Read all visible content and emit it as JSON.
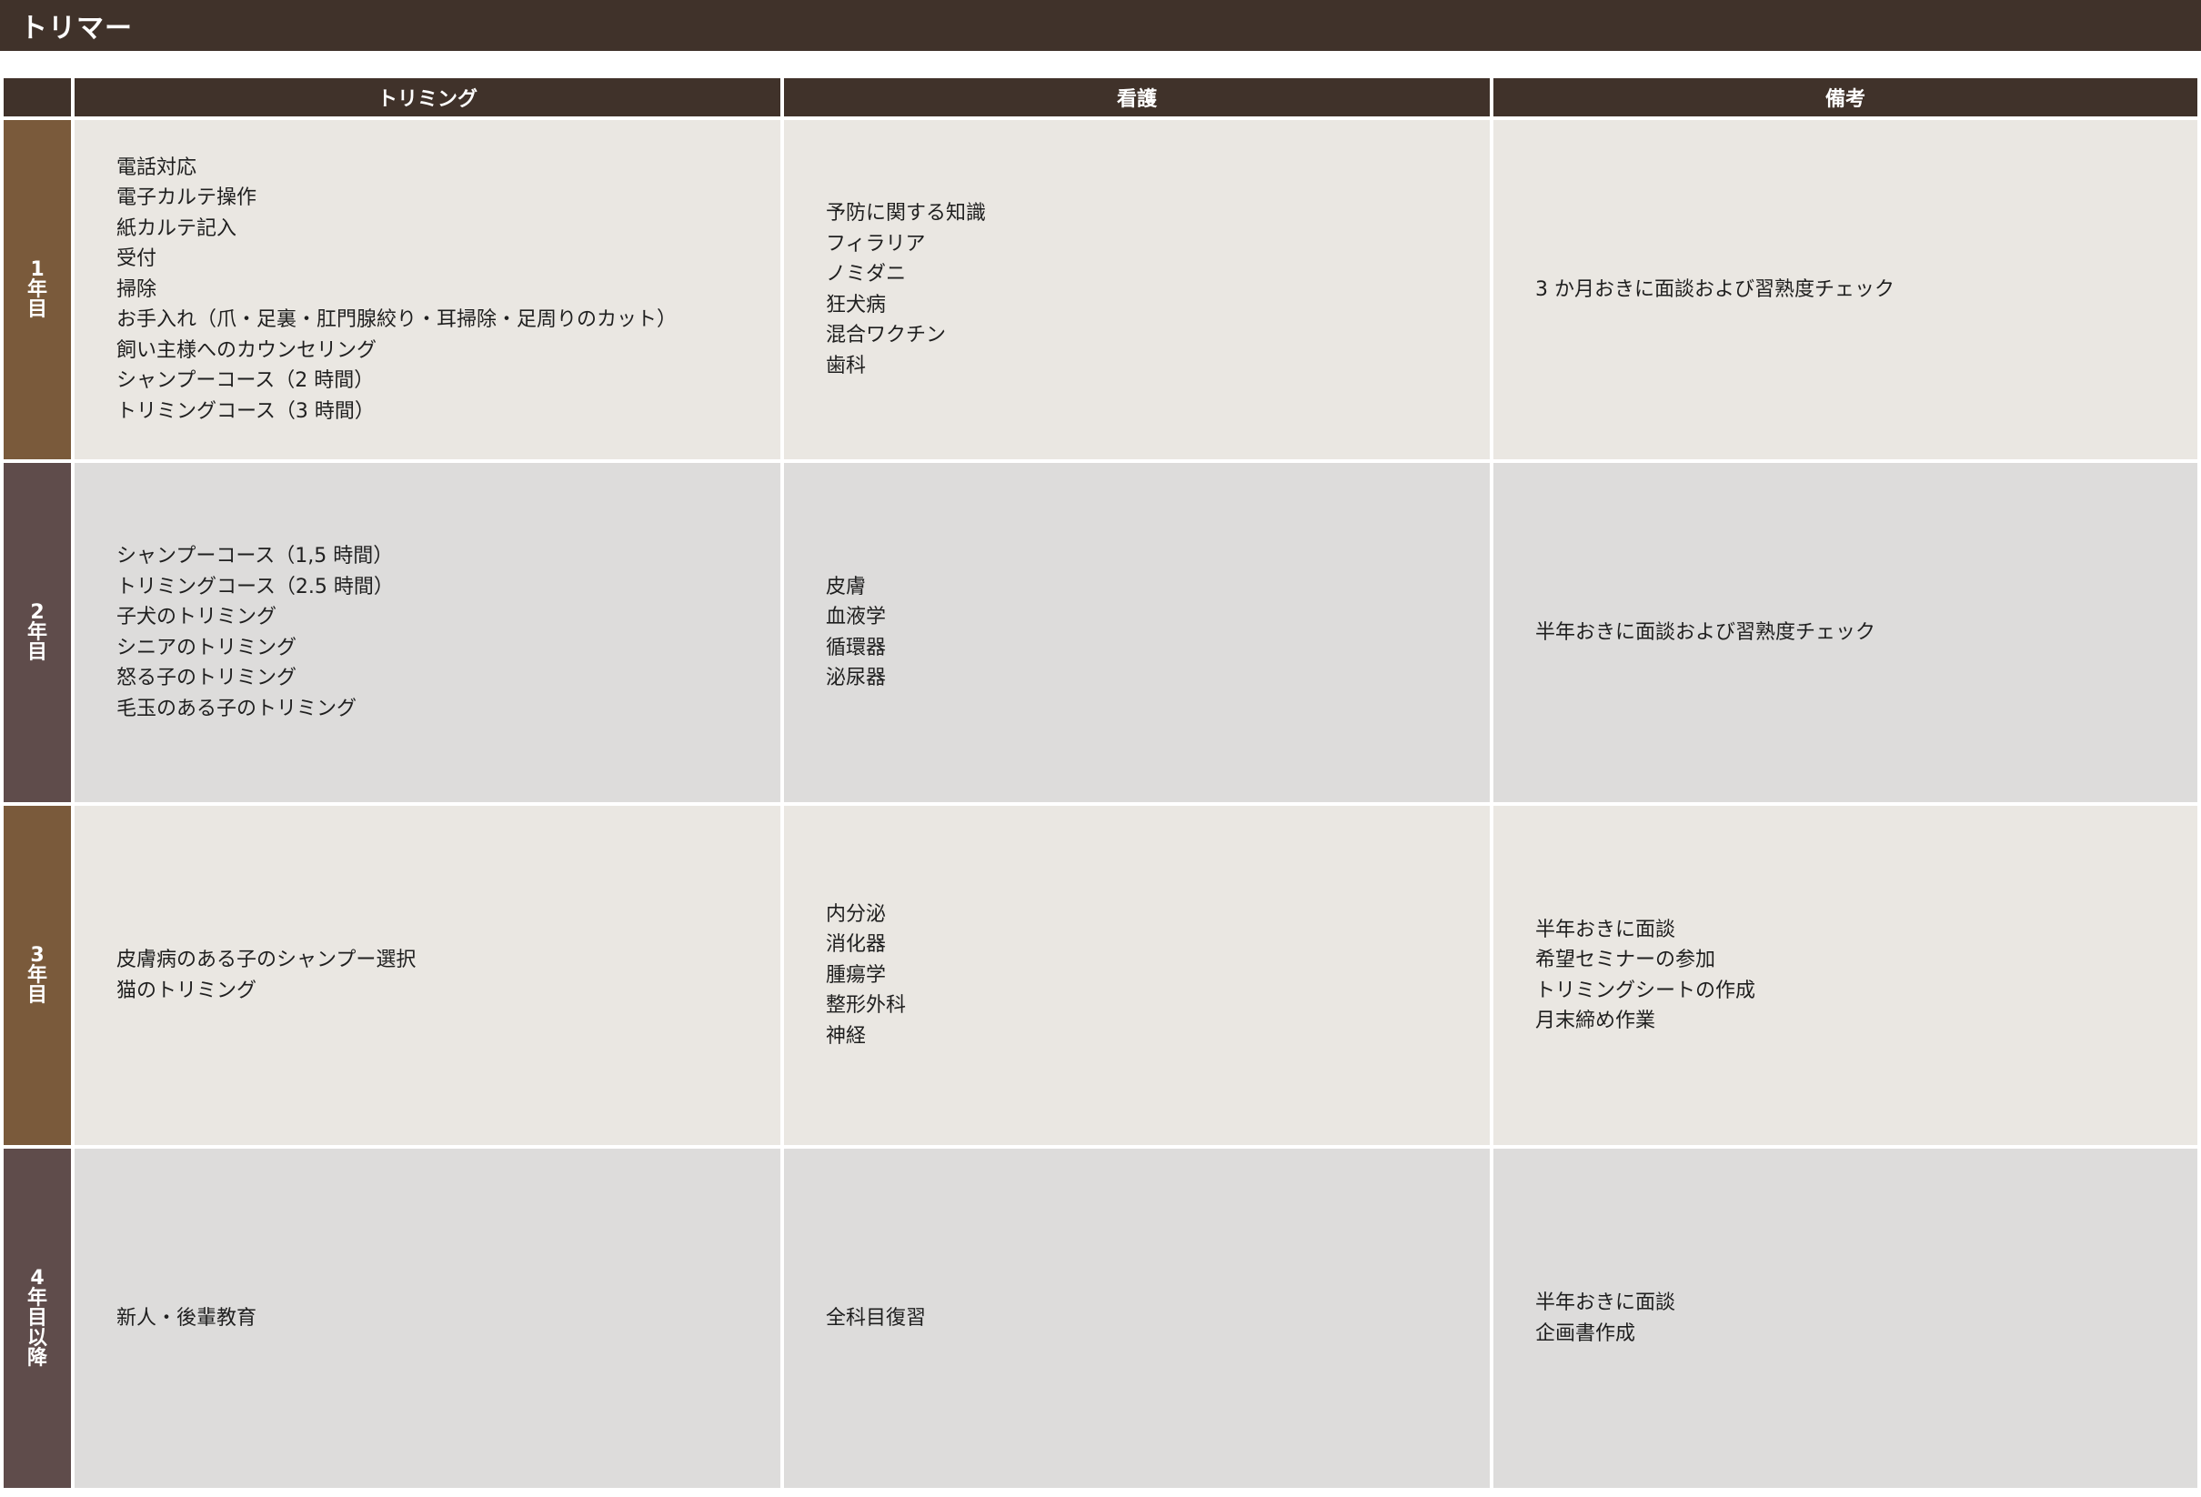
{
  "title": "トリマー",
  "headers": [
    "トリミング",
    "看護",
    "備考"
  ],
  "rows": [
    {
      "year": "1年目",
      "trimming": [
        "電話対応",
        "電子カルテ操作",
        "紙カルテ記入",
        "受付",
        "掃除",
        "お手入れ（爪・足裏・肛門腺絞り・耳掃除・足周りのカット）",
        "飼い主様へのカウンセリング",
        "シャンプーコース（2 時間）",
        "トリミングコース（3 時間）"
      ],
      "nursing": [
        "予防に関する知識",
        "フィラリア",
        "ノミダニ",
        "狂犬病",
        "混合ワクチン",
        "歯科"
      ],
      "notes": [
        "3 か月おきに面談および習熟度チェック"
      ]
    },
    {
      "year": "2年目",
      "trimming": [
        "シャンプーコース（1,5 時間）",
        "トリミングコース（2.5 時間）",
        "子犬のトリミング",
        "シニアのトリミング",
        "怒る子のトリミング",
        "毛玉のある子のトリミング"
      ],
      "nursing": [
        "皮膚",
        "血液学",
        "循環器",
        "泌尿器"
      ],
      "notes": [
        "半年おきに面談および習熟度チェック"
      ]
    },
    {
      "year": "3年目",
      "trimming": [
        "皮膚病のある子のシャンプー選択",
        "猫のトリミング"
      ],
      "nursing": [
        "内分泌",
        "消化器",
        "腫瘍学",
        "整形外科",
        "神経"
      ],
      "notes": [
        "半年おきに面談",
        "希望セミナーの参加",
        "トリミングシートの作成",
        "月末締め作業"
      ]
    },
    {
      "year": "4年目以降",
      "trimming": [
        "新人・後輩教育"
      ],
      "nursing": [
        "全科目復習"
      ],
      "notes": [
        "半年おきに面談",
        "企画書作成"
      ]
    }
  ],
  "colors": {
    "header_bg": "#40322a",
    "year_brown": "#7a5a3b",
    "year_mauve": "#5f4c4b",
    "row_light": "#eae7e2",
    "row_dark": "#dddcdb"
  }
}
